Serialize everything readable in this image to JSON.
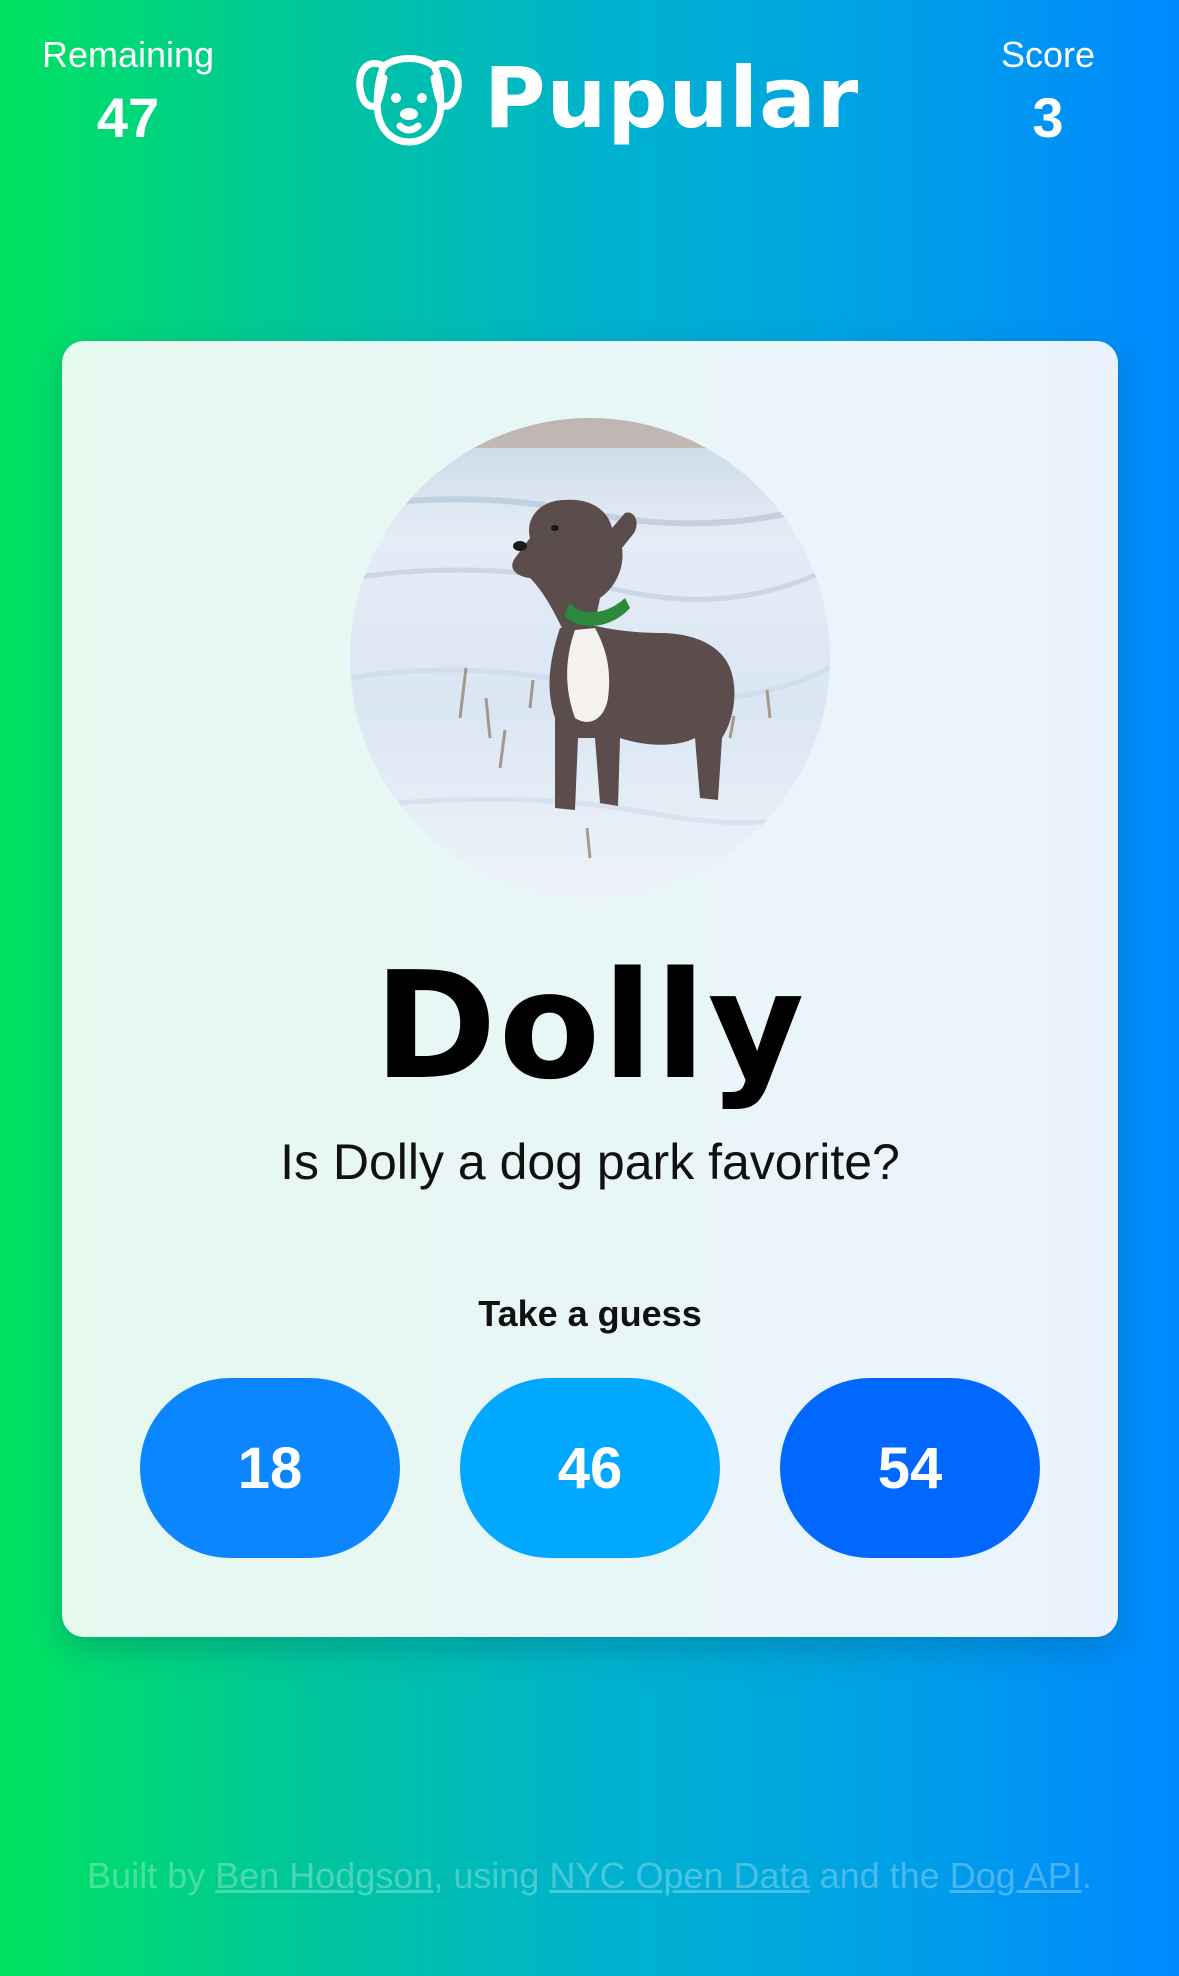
{
  "header": {
    "remaining_label": "Remaining",
    "remaining_value": "47",
    "brand_name": "Pupular",
    "score_label": "Score",
    "score_value": "3"
  },
  "card": {
    "photo_icon": "dog-photo",
    "dog_name": "Dolly",
    "question": "Is Dolly a dog park favorite?",
    "prompt": "Take a guess",
    "guesses": [
      "18",
      "46",
      "54"
    ]
  },
  "footer": {
    "text_built_by": "Built by ",
    "author_link": "Ben Hodgson",
    "text_using": ", using ",
    "data_link": "NYC Open Data",
    "text_and_the": " and the ",
    "api_link": "Dog API",
    "text_end": "."
  },
  "colors": {
    "gradient_start": "#00e35f",
    "gradient_end": "#0088ff",
    "guess_1": "#0c86ff",
    "guess_2": "#00a8ff",
    "guess_3": "#0067ff"
  }
}
